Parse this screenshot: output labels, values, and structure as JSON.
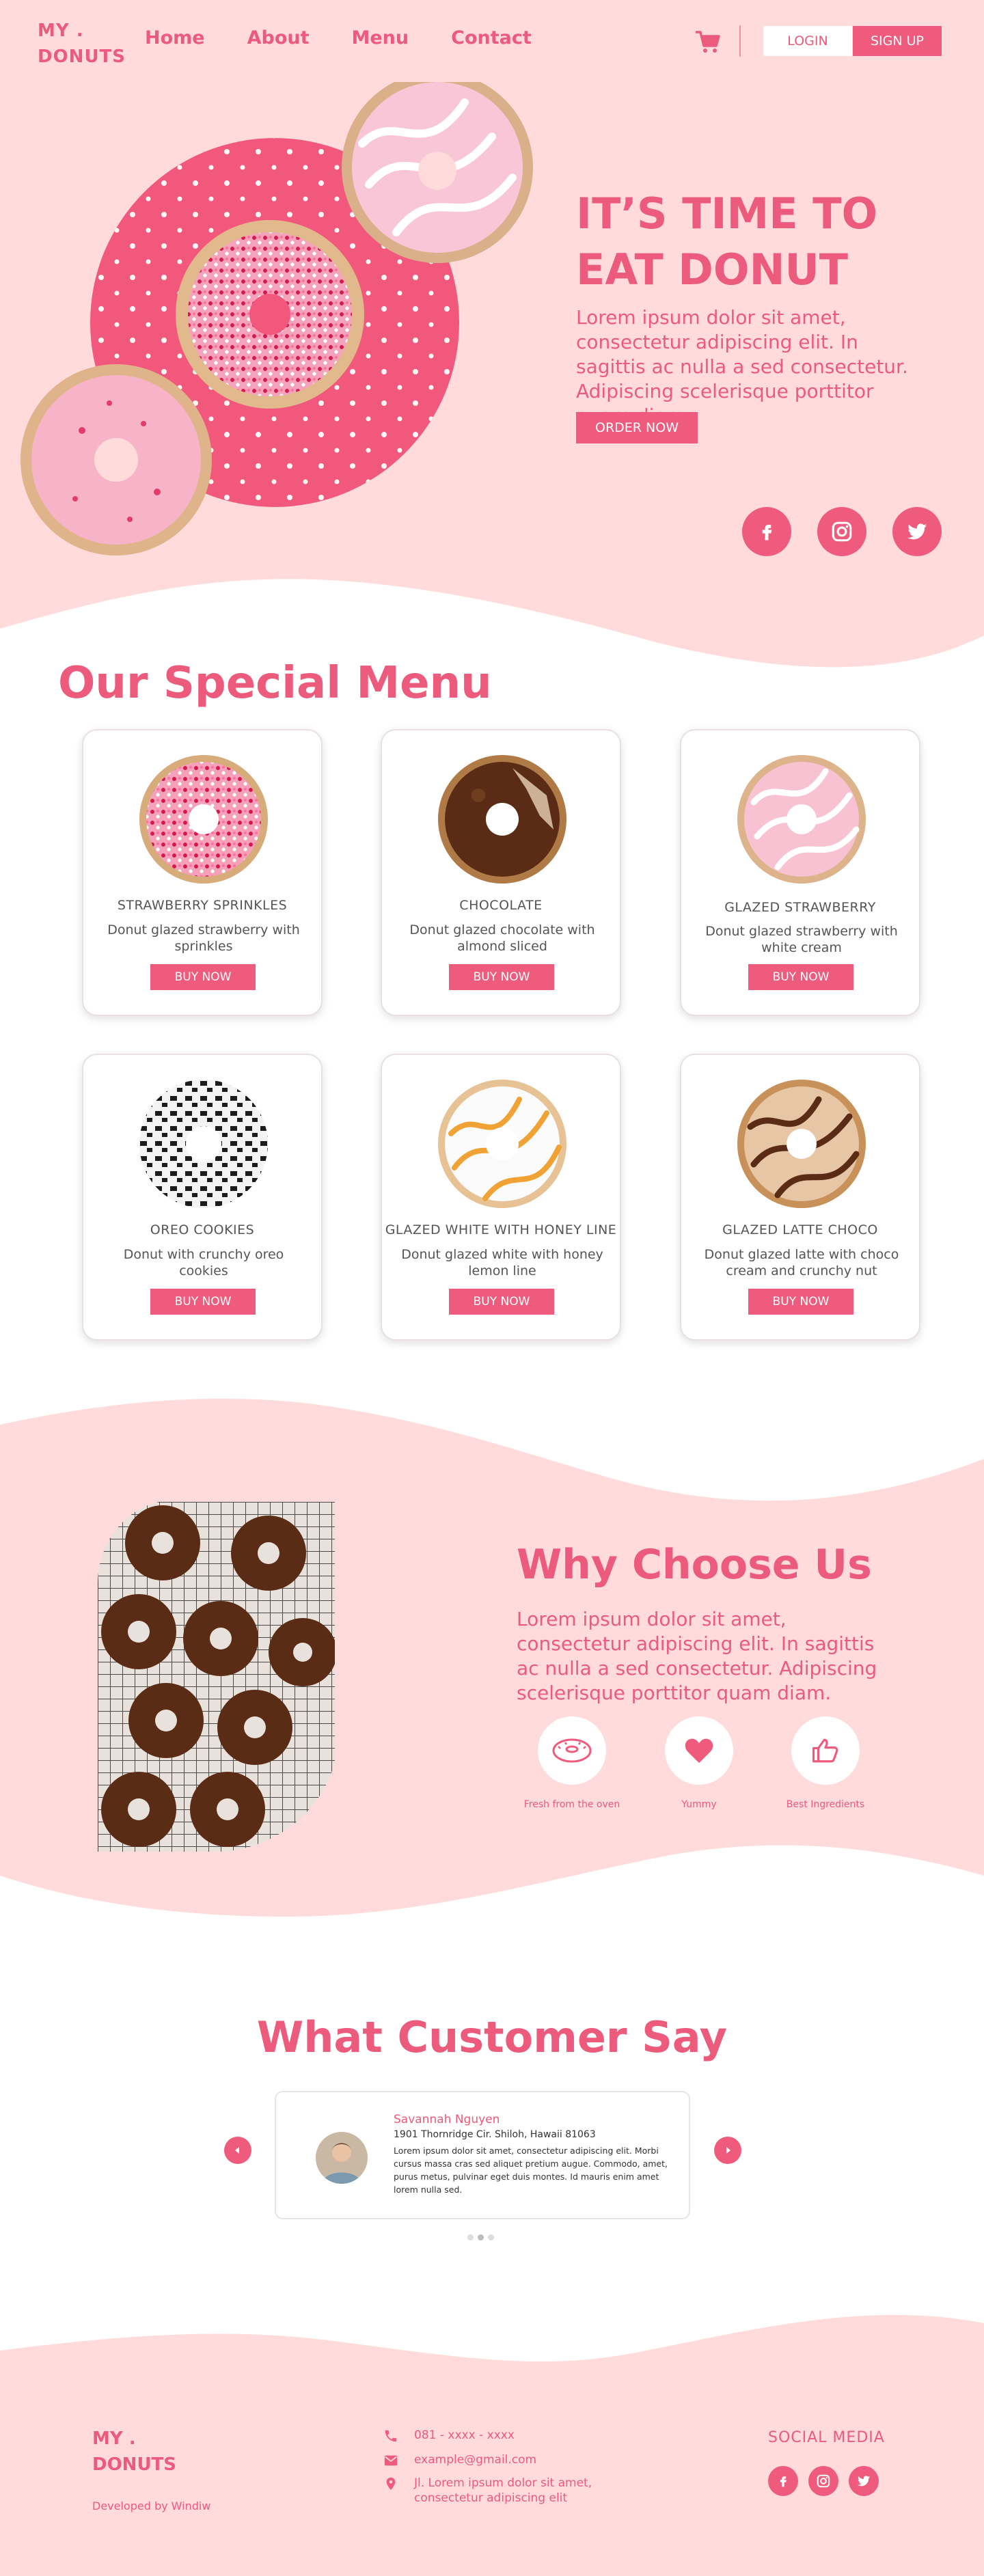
{
  "brand": {
    "line1": "MY .",
    "line2": "DONUTS"
  },
  "nav": {
    "items": [
      "Home",
      "About",
      "Menu",
      "Contact"
    ],
    "login": "LOGIN",
    "signup": "SIGN UP"
  },
  "hero": {
    "title": "IT’S TIME TO EAT DONUT",
    "text": "Lorem ipsum dolor sit amet, consectetur adipiscing elit. In sagittis ac nulla a sed consectetur. Adipiscing scelerisque porttitor quam diam.",
    "cta": "ORDER NOW",
    "social": [
      "facebook-icon",
      "instagram-icon",
      "twitter-icon"
    ]
  },
  "menu": {
    "heading": "Our Special Menu",
    "buy_label": "BUY NOW",
    "items": [
      {
        "name": "STRAWBERRY SPRINKLES",
        "desc": "Donut glazed strawberry with sprinkles"
      },
      {
        "name": "CHOCOLATE",
        "desc": "Donut glazed chocolate with almond sliced"
      },
      {
        "name": "GLAZED STRAWBERRY",
        "desc": "Donut glazed strawberry with white cream"
      },
      {
        "name": "OREO COOKIES",
        "desc": "Donut with crunchy oreo cookies"
      },
      {
        "name": "GLAZED WHITE WITH HONEY LINE",
        "desc": "Donut glazed white with honey lemon line"
      },
      {
        "name": "GLAZED LATTE CHOCO",
        "desc": "Donut glazed latte with choco cream and crunchy nut"
      }
    ]
  },
  "why": {
    "title": "Why Choose Us",
    "text": "Lorem ipsum dolor sit amet, consectetur adipiscing elit. In sagittis ac nulla a sed consectetur. Adipiscing scelerisque porttitor quam diam.",
    "features": [
      {
        "label": "Fresh from the oven",
        "icon": "donut-icon"
      },
      {
        "label": "Yummy",
        "icon": "heart-icon"
      },
      {
        "label": "Best Ingredients",
        "icon": "thumbs-up-icon"
      }
    ]
  },
  "testimonial": {
    "title": "What Customer Say",
    "name": "Savannah Nguyen",
    "address": "1901 Thornridge Cir. Shiloh, Hawaii 81063",
    "body": "Lorem ipsum dolor sit amet, consectetur adipiscing elit. Morbi cursus massa cras sed aliquet pretium augue. Commodo, amet, purus metus, pulvinar eget duis montes. Id mauris enim amet lorem nulla sed."
  },
  "footer": {
    "dev": "Developed by Windiw",
    "phone": "081 - xxxx - xxxx",
    "email": "example@gmail.com",
    "address": "Jl. Lorem ipsum dolor sit amet, consectetur adipiscing elit",
    "social_title": "SOCIAL MEDIA"
  },
  "colors": {
    "accent": "#ef5b7d",
    "bg_pink": "#ffdbdb",
    "text_pink": "#ec5a7c"
  }
}
